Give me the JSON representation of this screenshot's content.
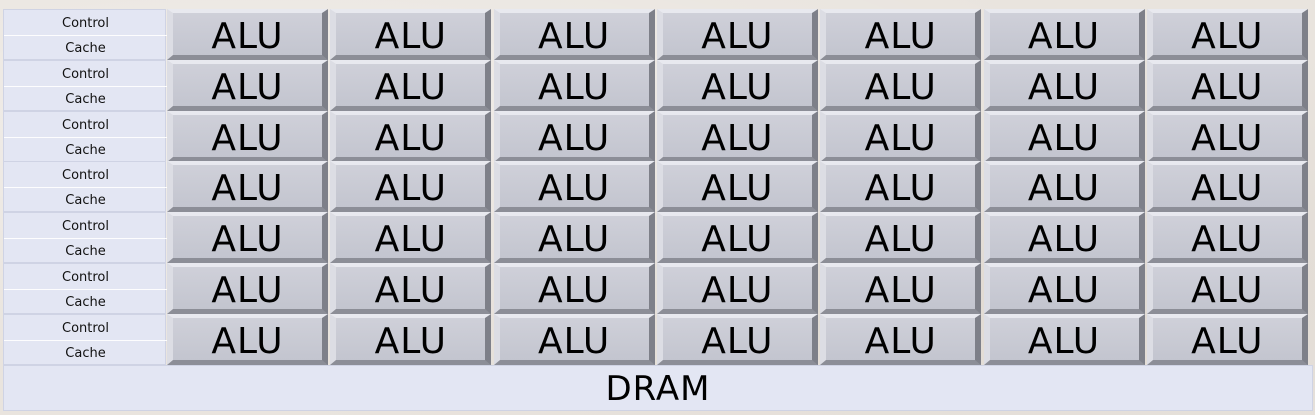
{
  "rows": [
    {
      "control": "Control",
      "cache": "Cache",
      "alus": [
        "ALU",
        "ALU",
        "ALU",
        "ALU",
        "ALU",
        "ALU",
        "ALU"
      ]
    },
    {
      "control": "Control",
      "cache": "Cache",
      "alus": [
        "ALU",
        "ALU",
        "ALU",
        "ALU",
        "ALU",
        "ALU",
        "ALU"
      ]
    },
    {
      "control": "Control",
      "cache": "Cache",
      "alus": [
        "ALU",
        "ALU",
        "ALU",
        "ALU",
        "ALU",
        "ALU",
        "ALU"
      ]
    },
    {
      "control": "Control",
      "cache": "Cache",
      "alus": [
        "ALU",
        "ALU",
        "ALU",
        "ALU",
        "ALU",
        "ALU",
        "ALU"
      ]
    },
    {
      "control": "Control",
      "cache": "Cache",
      "alus": [
        "ALU",
        "ALU",
        "ALU",
        "ALU",
        "ALU",
        "ALU",
        "ALU"
      ]
    },
    {
      "control": "Control",
      "cache": "Cache",
      "alus": [
        "ALU",
        "ALU",
        "ALU",
        "ALU",
        "ALU",
        "ALU",
        "ALU"
      ]
    },
    {
      "control": "Control",
      "cache": "Cache",
      "alus": [
        "ALU",
        "ALU",
        "ALU",
        "ALU",
        "ALU",
        "ALU",
        "ALU"
      ]
    }
  ],
  "dram": {
    "label": "DRAM"
  },
  "colors": {
    "block_fill": "#e3e6f3",
    "alu_fill": "#c8cad3",
    "background": "#e9e4de"
  }
}
